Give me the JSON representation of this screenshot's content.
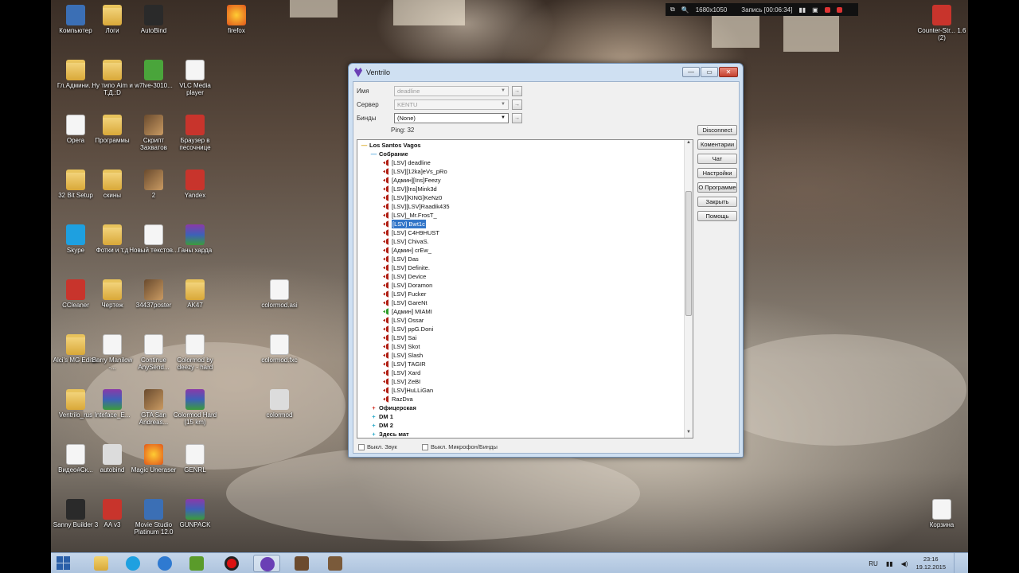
{
  "recording_bar": {
    "resolution": "1680x1050",
    "recording": "Запись [00:06:34]"
  },
  "desktop_icons": [
    {
      "label": "Компьютер",
      "icon": "computer-icon"
    },
    {
      "label": "Логи",
      "icon": "folder-icon"
    },
    {
      "label": "AutoBind",
      "icon": "app-icon"
    },
    {
      "label": "firefox",
      "icon": "firefox-icon"
    },
    {
      "label": "Гл.Админи...",
      "icon": "folder-icon"
    },
    {
      "label": "Ну типо Aim и Т.Д.:D",
      "icon": "folder-icon"
    },
    {
      "label": "w7lve-3010...",
      "icon": "xbox-icon"
    },
    {
      "label": "VLC Media player",
      "icon": "file-icon"
    },
    {
      "label": "Opera",
      "icon": "document-icon"
    },
    {
      "label": "Программы",
      "icon": "folder-icon"
    },
    {
      "label": "Скрипт Захватов",
      "icon": "photo-icon"
    },
    {
      "label": "Браузер в песочнице",
      "icon": "sandbox-icon"
    },
    {
      "label": "32 Bit Setup",
      "icon": "folder-icon"
    },
    {
      "label": "скины",
      "icon": "folder-icon"
    },
    {
      "label": "2",
      "icon": "image-icon"
    },
    {
      "label": "Yandex",
      "icon": "yandex-icon"
    },
    {
      "label": "Skype",
      "icon": "skype-icon"
    },
    {
      "label": "Фотки и т.д",
      "icon": "folder-icon"
    },
    {
      "label": "Новый текстов...",
      "icon": "file-icon"
    },
    {
      "label": "Ганы харда",
      "icon": "rar-icon"
    },
    {
      "label": "CCleaner",
      "icon": "ccleaner-icon"
    },
    {
      "label": "Чертеж",
      "icon": "folder-icon"
    },
    {
      "label": "34437poster",
      "icon": "image-icon"
    },
    {
      "label": "AK47",
      "icon": "folder-icon"
    },
    {
      "label": "colormod.asi",
      "icon": "file-icon"
    },
    {
      "label": "Alci's MG Editor",
      "icon": "folder-icon"
    },
    {
      "label": "Barry Manilow -...",
      "icon": "music-icon"
    },
    {
      "label": "Continue AnySend...",
      "icon": "file-icon"
    },
    {
      "label": "Colormod by deezy - hard",
      "icon": "file-icon"
    },
    {
      "label": "colormod.fxc",
      "icon": "file-icon"
    },
    {
      "label": "Ventrilo_rus",
      "icon": "folder-icon"
    },
    {
      "label": "Inteface_E...",
      "icon": "rar-icon"
    },
    {
      "label": "GTA San Andreas...",
      "icon": "gta-icon"
    },
    {
      "label": "Colormod Hard (15 km)",
      "icon": "rar-icon"
    },
    {
      "label": "colormod",
      "icon": "settings-file-icon"
    },
    {
      "label": "Видео#Ск...",
      "icon": "file-icon"
    },
    {
      "label": "autobind",
      "icon": "settings-file-icon"
    },
    {
      "label": "Magic Uneraser",
      "icon": "magic-icon"
    },
    {
      "label": "GENRL",
      "icon": "file-icon"
    },
    {
      "label": "Sanny Builder 3",
      "icon": "sanny-icon"
    },
    {
      "label": "AA v3",
      "icon": "aa-icon"
    },
    {
      "label": "Movie Studio Platinum 12.0",
      "icon": "movie-icon"
    },
    {
      "label": "GUNPACK",
      "icon": "rar-icon"
    },
    {
      "label": "Counter-Str... 1.6 (2)",
      "icon": "cs-icon"
    },
    {
      "label": "Корзина",
      "icon": "recycle-bin-icon"
    }
  ],
  "window": {
    "title": "Ventrilo",
    "name_label": "Имя",
    "name_value": "deadline",
    "server_label": "Сервер",
    "server_value": "KENTU",
    "binds_label": "Бинды",
    "binds_value": "(None)",
    "ping": "Ping: 32",
    "side_buttons": [
      "Disconnect",
      "Коментарии",
      "Чат",
      "Настройки",
      "О Программе",
      "Закрыть",
      "Помощь"
    ],
    "tree": {
      "root": "Los Santos Vagos",
      "channel": "Собрание",
      "users": [
        "[LSV] deadline",
        "[LSV][12ka]eVs_pRo",
        "[Админ][Ins]Feezy",
        "[LSV][Ins]Mink3d",
        "[LSV][KING]KeNz0",
        "[LSV][LSV]Raadik435",
        "[LSV]_Mr.FrosT_",
        "[LSV] Bwt1c",
        "[LSV] C4H9HUST",
        "[LSV] ChivaS.",
        "[Админ] crEw_",
        "[LSV] Das",
        "[LSV] Definite.",
        "[LSV] Device",
        "[LSV] Doramon",
        "[LSV] Fucker",
        "[LSV] GareNt",
        "[Админ] MIAMI",
        "[LSV] Ossar",
        "[LSV] ppG.Doni",
        "[LSV] Sai",
        "[LSV] Skot",
        "[LSV] Slash",
        "[LSV] TAGIR",
        "[LSV] Xard",
        "[LSV] ZeBI",
        "[LSV]HuLLiGan",
        "RazDva"
      ],
      "selected": "[LSV] Bwt1c",
      "other_channels": [
        "Офицерская",
        "DM 1",
        "DM 2",
        "Здесь мат"
      ]
    },
    "mute_sound": "Выкл. Звук",
    "mute_mic": "Выкл. Микрофон/Бинды"
  },
  "taskbar": {
    "language": "RU",
    "time": "23:16",
    "date": "19.12.2015"
  }
}
